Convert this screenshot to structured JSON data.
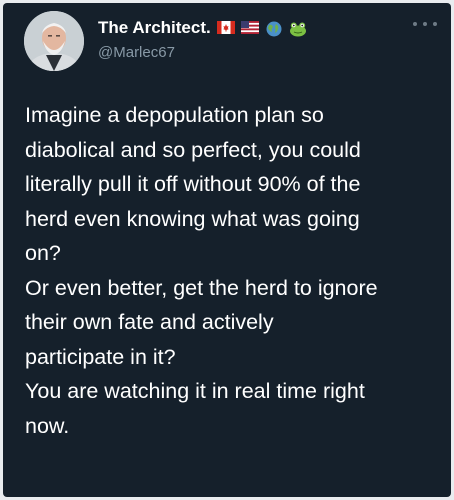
{
  "tweet": {
    "author": {
      "display_name": "The Architect.",
      "handle": "@Marlec67",
      "name_emojis": [
        "canada-flag-icon",
        "us-flag-icon",
        "globe-icon",
        "frog-icon"
      ],
      "avatar": "avatar-photo"
    },
    "menu_icon": "more-options-icon",
    "text_lines": [
      "Imagine a depopulation plan so",
      "diabolical and so perfect, you could",
      "literally pull it off without 90% of the",
      "herd even knowing what was going",
      "on?",
      "Or even better, get the herd to ignore",
      "their own fate and actively",
      "participate in it?",
      "You are watching it in real time right",
      "now."
    ]
  },
  "colors": {
    "background": "#15202b",
    "text_primary": "#ffffff",
    "text_secondary": "#8899a6"
  }
}
